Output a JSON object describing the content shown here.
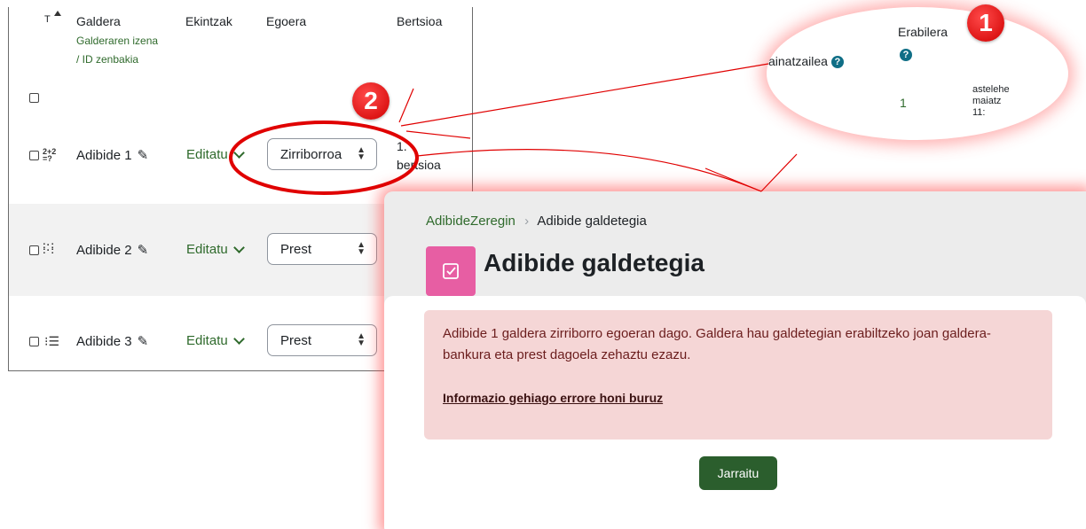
{
  "bank": {
    "sort_indicator": "T",
    "columns": {
      "question": "Galdera",
      "question_sub1": "Galderaren izena",
      "question_sub2": "/ ID zenbakia",
      "actions": "Ekintzak",
      "status": "Egoera",
      "version": "Bertsioa"
    },
    "rows": [
      {
        "type_icon": "calculated-icon",
        "name": "Adibide 1",
        "action": "Editatu",
        "status": "Zirriborroa",
        "version_line1": "1.",
        "version_line2": "bertsioa"
      },
      {
        "type_icon": "matching-icon",
        "name": "Adibide 2",
        "action": "Editatu",
        "status": "Prest"
      },
      {
        "type_icon": "multichoice-icon",
        "name": "Adibide 3",
        "action": "Editatu",
        "status": "Prest"
      }
    ]
  },
  "bubble": {
    "col_left": "ainatzailea",
    "col_usage": "Erabilera",
    "usage_value": "1",
    "date_line1": "astelehe",
    "date_line2": "maiatz",
    "date_line3": "11:"
  },
  "callouts": {
    "one": "1",
    "two": "2"
  },
  "page": {
    "breadcrumb_course": "AdibideZeregin",
    "breadcrumb_separator": "›",
    "breadcrumb_current": "Adibide galdetegia",
    "title": "Adibide galdetegia",
    "alert_text": "Adibide 1 galdera zirriborro egoeran dago. Galdera hau galdetegian erabiltzeko joan galdera-bankura eta prest dagoela zehaztu ezazu.",
    "alert_link": "Informazio gehiago errore honi buruz",
    "continue_button": "Jarraitu"
  },
  "colors": {
    "accent_green": "#2f6a2c",
    "button_green": "#2b5e2d",
    "alert_bg": "#f5d6d6",
    "callout_red": "#e00000",
    "quiz_icon_pink": "#e75ea3"
  }
}
